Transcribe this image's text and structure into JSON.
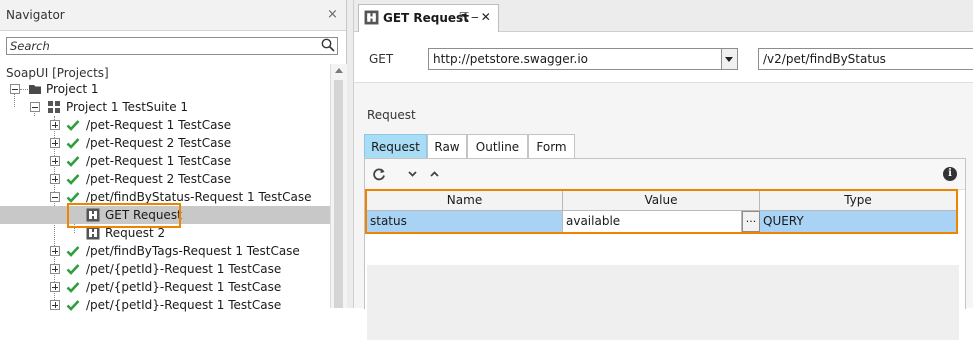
{
  "navigator": {
    "title": "Navigator",
    "close_glyph": "×",
    "search_placeholder": "Search",
    "root_label": "SoapUI [Projects]",
    "tree": [
      {
        "label": "Project 1",
        "icon": "folder-icon"
      },
      {
        "label": "Project 1 TestSuite 1",
        "icon": "testsuite-icon"
      },
      {
        "label": "/pet-Request 1 TestCase",
        "icon": "check-icon"
      },
      {
        "label": "/pet-Request 2 TestCase",
        "icon": "check-icon"
      },
      {
        "label": "/pet-Request 1 TestCase",
        "icon": "check-icon"
      },
      {
        "label": "/pet-Request 2 TestCase",
        "icon": "check-icon"
      },
      {
        "label": "/pet/findByStatus-Request 1 TestCase",
        "icon": "check-icon"
      },
      {
        "label": "GET Request",
        "icon": "request-step-icon",
        "selected": true
      },
      {
        "label": "Request 2",
        "icon": "request-step-icon"
      },
      {
        "label": "/pet/findByTags-Request 1 TestCase",
        "icon": "check-icon"
      },
      {
        "label": "/pet/{petId}-Request 1 TestCase",
        "icon": "check-icon"
      },
      {
        "label": "/pet/{petId}-Request 1 TestCase",
        "icon": "check-icon"
      },
      {
        "label": "/pet/{petId}-Request 1 TestCase",
        "icon": "check-icon"
      }
    ]
  },
  "editor": {
    "tab_title": "GET Request",
    "tab_controls": "⇱‒✕",
    "method": "GET",
    "endpoint": "http://petstore.swagger.io",
    "resource": "/v2/pet/findByStatus",
    "section_label": "Request",
    "tabs": [
      "Request",
      "Raw",
      "Outline",
      "Form"
    ],
    "active_tab": "Request",
    "info_glyph": "i",
    "grid": {
      "headers": [
        "Name",
        "Value",
        "Type"
      ],
      "rows": [
        {
          "name": "status",
          "value": "available",
          "type": "QUERY"
        }
      ],
      "ellipsis": "..."
    }
  },
  "colors": {
    "highlight": "#f08300",
    "selection": "#a9d3f5",
    "active_tab": "#a9dcf5",
    "check": "#2e9e3e"
  }
}
